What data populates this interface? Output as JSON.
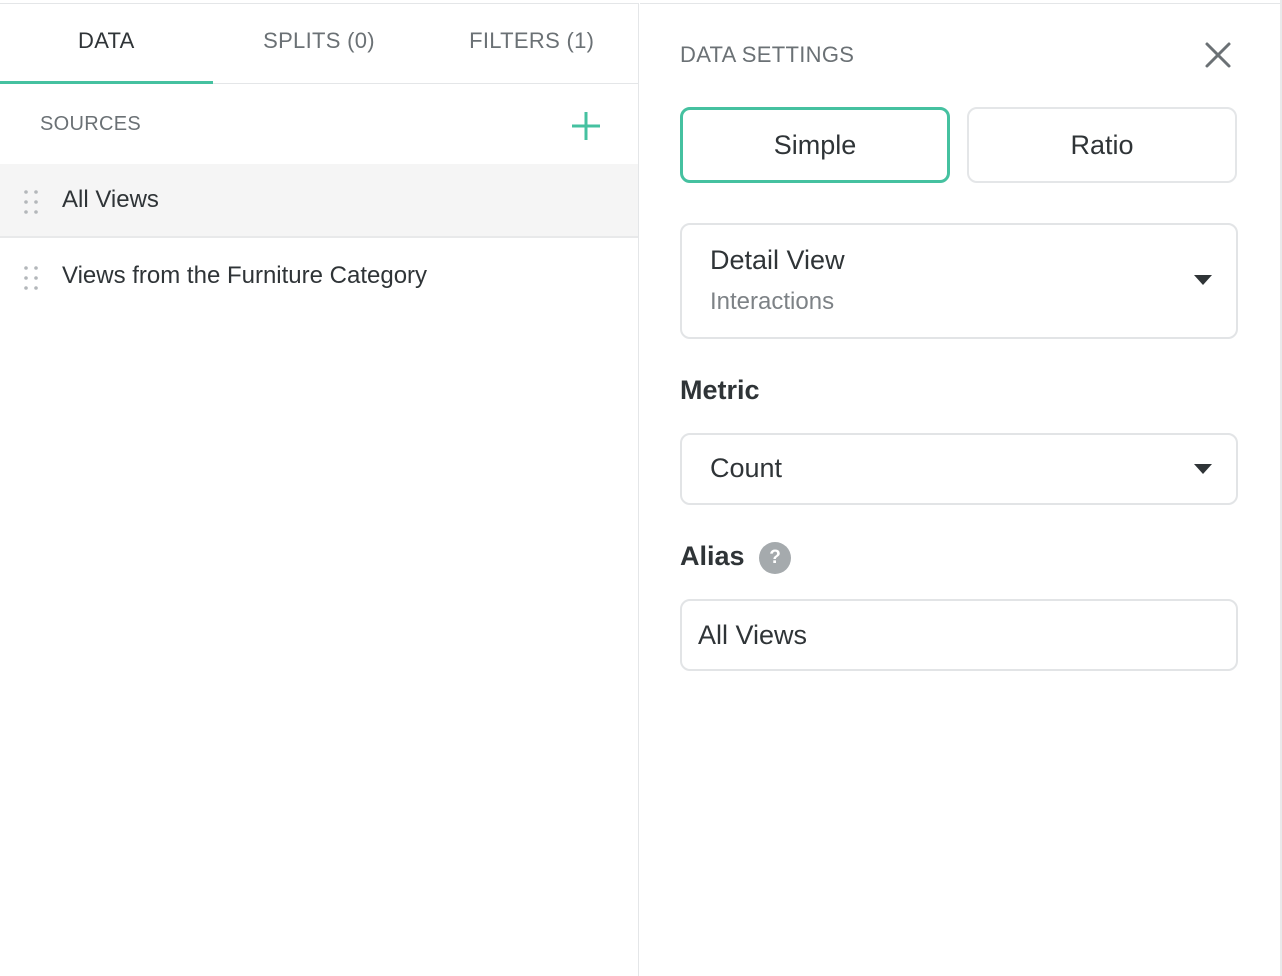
{
  "tabs": [
    {
      "label": "DATA",
      "active": true
    },
    {
      "label": "SPLITS (0)",
      "active": false
    },
    {
      "label": "FILTERS (1)",
      "active": false
    }
  ],
  "sources": {
    "header": "SOURCES",
    "add_icon": "plus-icon",
    "items": [
      {
        "label": "All Views",
        "selected": true
      },
      {
        "label": "Views from the Furniture Category",
        "selected": false
      }
    ]
  },
  "settings": {
    "title": "DATA SETTINGS",
    "close_icon": "close-icon",
    "modes": [
      {
        "label": "Simple",
        "selected": true
      },
      {
        "label": "Ratio",
        "selected": false
      }
    ],
    "source_select": {
      "primary": "Detail View",
      "secondary": "Interactions"
    },
    "metric": {
      "label": "Metric",
      "value": "Count"
    },
    "alias": {
      "label": "Alias",
      "help_icon": "question-icon",
      "help_glyph": "?",
      "value": "All Views"
    }
  },
  "colors": {
    "accent": "#45c1a0",
    "text": "#2f3437",
    "muted": "#6b7175",
    "border": "#e2e4e6"
  }
}
